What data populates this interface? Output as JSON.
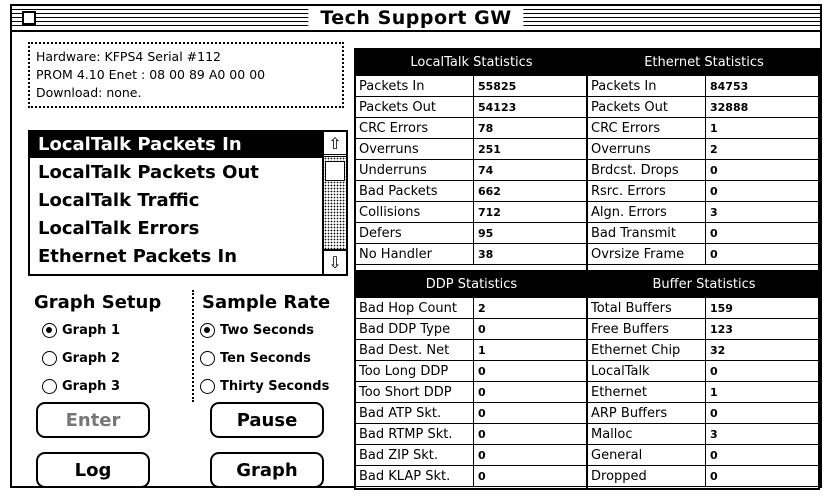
{
  "window": {
    "title": "Tech Support GW"
  },
  "hardware": {
    "line1": "Hardware:  KFPS4  Serial #112",
    "line2": "PROM 4.10   Enet : 08 00 89 A0 00 00",
    "line3": "Download: none."
  },
  "graph_list": {
    "items": [
      "LocalTalk Packets In",
      "LocalTalk Packets Out",
      "LocalTalk Traffic",
      "LocalTalk Errors",
      "Ethernet Packets In"
    ],
    "selected": 0
  },
  "graph_setup": {
    "title": "Graph Setup",
    "options": [
      "Graph 1",
      "Graph 2",
      "Graph 3"
    ],
    "selected": 0
  },
  "sample_rate": {
    "title": "Sample Rate",
    "options": [
      "Two Seconds",
      "Ten Seconds",
      "Thirty Seconds"
    ],
    "selected": 0
  },
  "buttons": {
    "enter": "Enter",
    "pause": "Pause",
    "log": "Log",
    "graph": "Graph"
  },
  "localtalk": {
    "title": "LocalTalk Statistics",
    "rows": [
      {
        "label": "Packets In",
        "value": "55825"
      },
      {
        "label": "Packets Out",
        "value": "54123"
      },
      {
        "label": "CRC Errors",
        "value": "78"
      },
      {
        "label": "Overruns",
        "value": "251"
      },
      {
        "label": "Underruns",
        "value": "74"
      },
      {
        "label": "Bad Packets",
        "value": "662"
      },
      {
        "label": "Collisions",
        "value": "712"
      },
      {
        "label": "Defers",
        "value": "95"
      },
      {
        "label": "No Handler",
        "value": "38"
      }
    ]
  },
  "ethernet": {
    "title": "Ethernet Statistics",
    "rows": [
      {
        "label": "Packets In",
        "value": "84753"
      },
      {
        "label": "Packets Out",
        "value": "32888"
      },
      {
        "label": "CRC Errors",
        "value": "1"
      },
      {
        "label": "Overruns",
        "value": "2"
      },
      {
        "label": "Brdcst. Drops",
        "value": "0"
      },
      {
        "label": "Rsrc. Errors",
        "value": "0"
      },
      {
        "label": "Algn. Errors",
        "value": "3"
      },
      {
        "label": "Bad Transmit",
        "value": "0"
      },
      {
        "label": "Ovrsize Frame",
        "value": "0"
      }
    ]
  },
  "ddp": {
    "title": "DDP Statistics",
    "rows": [
      {
        "label": "Bad Hop Count",
        "value": "2"
      },
      {
        "label": "Bad DDP Type",
        "value": "0"
      },
      {
        "label": "Bad Dest. Net",
        "value": "1"
      },
      {
        "label": "Too Long DDP",
        "value": "0"
      },
      {
        "label": "Too Short DDP",
        "value": "0"
      },
      {
        "label": "Bad ATP Skt.",
        "value": "0"
      },
      {
        "label": "Bad RTMP Skt.",
        "value": "0"
      },
      {
        "label": "Bad ZIP Skt.",
        "value": "0"
      },
      {
        "label": "Bad KLAP Skt.",
        "value": "0"
      }
    ]
  },
  "buffer": {
    "title": "Buffer Statistics",
    "rows": [
      {
        "label": "Total Buffers",
        "value": "159"
      },
      {
        "label": "Free Buffers",
        "value": "123"
      },
      {
        "label": "Ethernet Chip",
        "value": "32"
      },
      {
        "label": "LocalTalk",
        "value": "0"
      },
      {
        "label": "Ethernet",
        "value": "1"
      },
      {
        "label": "ARP Buffers",
        "value": "0"
      },
      {
        "label": "Malloc",
        "value": "3"
      },
      {
        "label": "General",
        "value": "0"
      },
      {
        "label": "Dropped",
        "value": "0"
      }
    ]
  }
}
